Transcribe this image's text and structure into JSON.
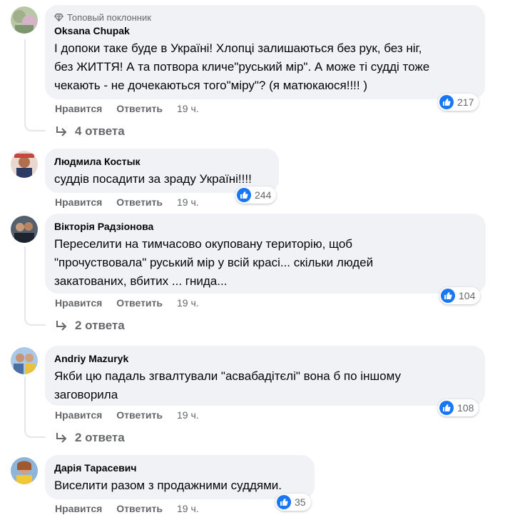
{
  "comments": [
    {
      "author": "Oksana Chupak",
      "badge": "Топовый поклонник",
      "text": "І допоки таке буде в Україні! Хлопці залишаються без рук, без ніг,\nбез ЖИТТЯ! А та потвора кличе\"руський мір\". А може ті судді тоже\nчекають - не дочекаються того\"міру\"? (я матюкаюся!!!! )",
      "likes": "217",
      "time": "19 ч.",
      "replies": "4 ответа"
    },
    {
      "author": "Людмила Костык",
      "text": "суддів посадити за зраду Україні!!!!",
      "likes": "244",
      "time": "19 ч."
    },
    {
      "author": "Вікторія Радзіонова",
      "text": "Переселити на тимчасово окуповану територію, щоб\n\"прочуствовала\" руський мір у всій красі... скільки людей\nзакатованих, вбитих ... гнида...",
      "likes": "104",
      "time": "19 ч.",
      "replies": "2 ответа"
    },
    {
      "author": "Andriy Mazuryk",
      "text": "Якби цю падаль згвалтували \"асвабадітєлі\" вона б по іншому\nзаговорила",
      "likes": "108",
      "time": "19 ч.",
      "replies": "2 ответа"
    },
    {
      "author": "Дарія Тарасевич",
      "text": "Виселити разом з продажними суддями.",
      "likes": "35",
      "time": "19 ч."
    }
  ],
  "actions": {
    "like": "Нравится",
    "reply": "Ответить"
  },
  "colors": {
    "bubble": "#f0f2f5",
    "like_blue": "#1877f2",
    "secondary_text": "#65676b"
  },
  "icons": {
    "badge": "diamond-icon",
    "like": "thumbs-up-icon",
    "replies": "reply-arrow-icon"
  }
}
